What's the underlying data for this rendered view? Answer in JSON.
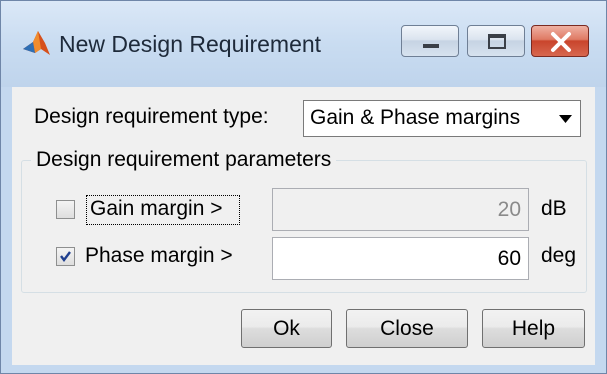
{
  "window": {
    "title": "New Design Requirement"
  },
  "form": {
    "type_label": "Design requirement type:",
    "type_selected": "Gain & Phase margins",
    "group_title": "Design requirement parameters",
    "gain": {
      "label": "Gain margin >",
      "checked": false,
      "value": "20",
      "unit": "dB"
    },
    "phase": {
      "label": "Phase margin >",
      "checked": true,
      "value": "60",
      "unit": "deg"
    }
  },
  "buttons": {
    "ok": "Ok",
    "close": "Close",
    "help": "Help"
  },
  "icons": {
    "title": "matlab-logo-icon",
    "minimize": "minimize-icon",
    "maximize": "maximize-icon",
    "close": "close-icon",
    "dropdown": "chevron-down-icon",
    "checkmark": "checkmark-icon"
  },
  "colors": {
    "titlebar": "#c9dcf1",
    "close_button": "#c9452c",
    "dialog_background": "#f0f0f0",
    "checkmark": "#1f3f8f"
  }
}
